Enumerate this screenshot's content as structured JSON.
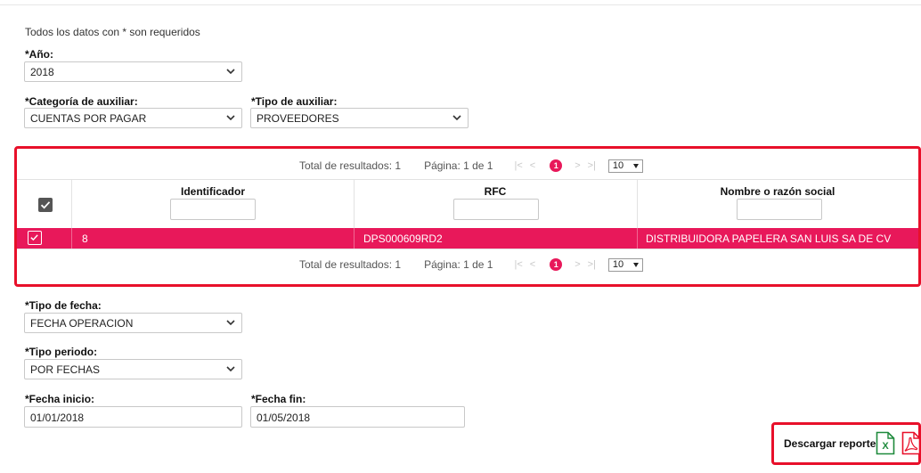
{
  "form": {
    "required_note": "Todos los datos con * son requeridos",
    "anio": {
      "label": "*Año:",
      "value": "2018"
    },
    "categoria": {
      "label": "*Categoría de auxiliar:",
      "value": "CUENTAS POR PAGAR"
    },
    "tipo_auxiliar": {
      "label": "*Tipo de auxiliar:",
      "value": "PROVEEDORES"
    },
    "tipo_fecha": {
      "label": "*Tipo de fecha:",
      "value": "FECHA OPERACION"
    },
    "tipo_periodo": {
      "label": "*Tipo periodo:",
      "value": "POR FECHAS"
    },
    "fecha_inicio": {
      "label": "*Fecha inicio:",
      "value": "01/01/2018"
    },
    "fecha_fin": {
      "label": "*Fecha fin:",
      "value": "01/05/2018"
    }
  },
  "table": {
    "pager": {
      "total_label": "Total de resultados: 1",
      "page_label": "Página: 1 de 1",
      "first": "|<",
      "prev": "<",
      "current_page": "1",
      "next": ">",
      "last": ">|",
      "page_size": "10"
    },
    "columns": [
      "Identificador",
      "RFC",
      "Nombre o razón social"
    ],
    "rows": [
      {
        "identificador": "8",
        "rfc": "DPS000609RD2",
        "nombre": "DISTRIBUIDORA PAPELERA SAN LUIS SA DE CV",
        "selected": true
      }
    ]
  },
  "download": {
    "label": "Descargar reporte:",
    "excel_glyph": "X"
  },
  "colors": {
    "accent": "#e8185a",
    "highlight_border": "#e8102a",
    "excel_green": "#1e8a3c",
    "pdf_red": "#e8102a"
  },
  "icons": {
    "select_chevron": "chevron-down-icon",
    "checkbox": "checkbox-checked-icon",
    "excel": "excel-file-icon",
    "pdf": "pdf-file-icon"
  }
}
